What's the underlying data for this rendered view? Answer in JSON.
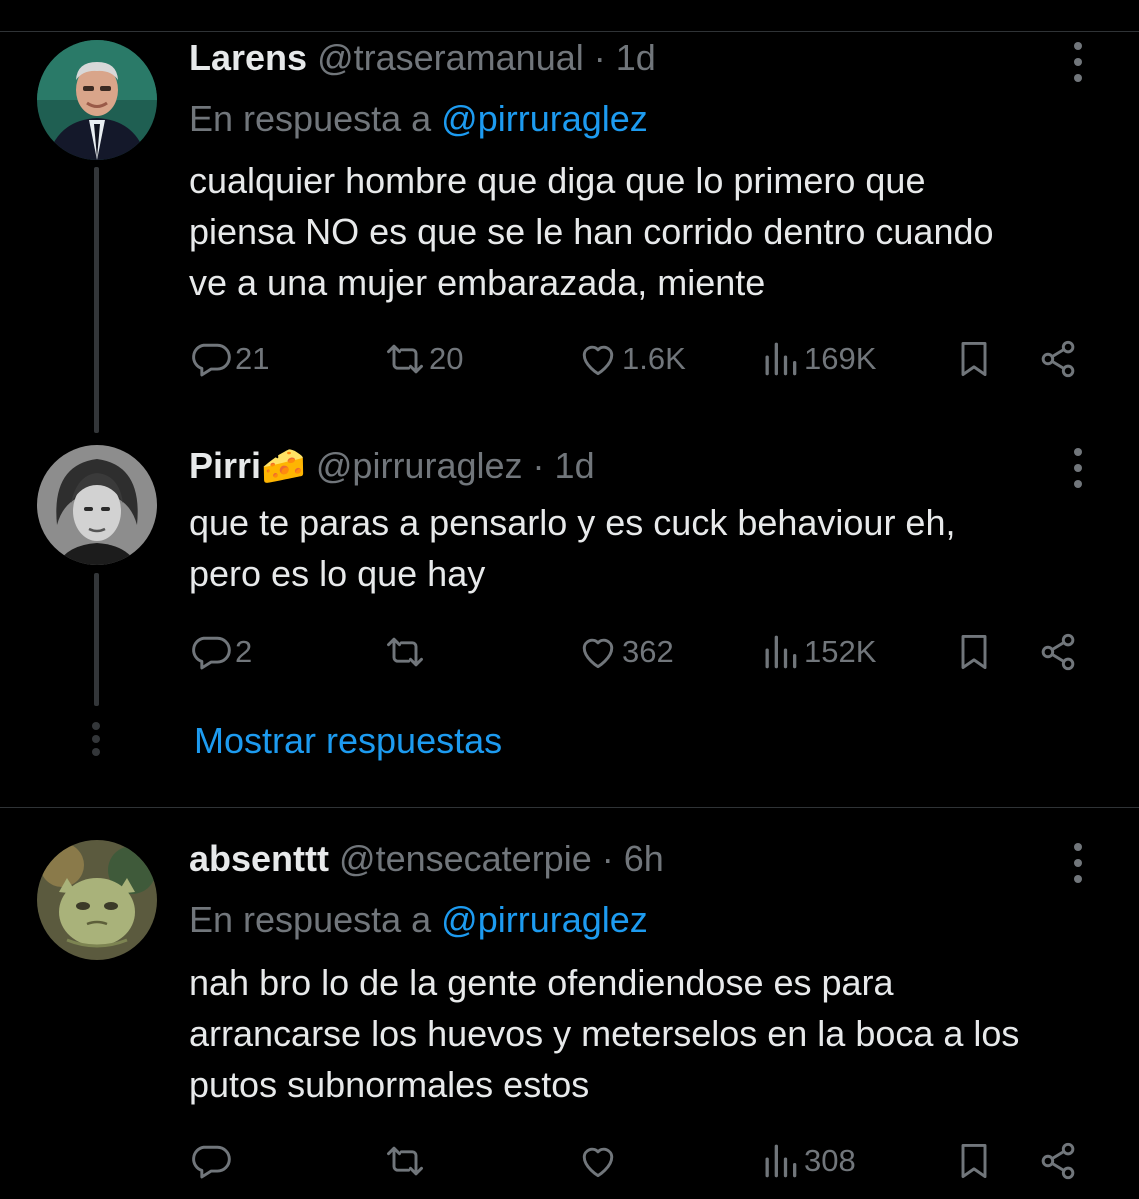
{
  "tweets": [
    {
      "name": "Larens",
      "handle": "@traseramanual",
      "separator": "·",
      "time": "1d",
      "reply_prefix": "En respuesta a",
      "reply_to": "@pirruraglez",
      "text_lines": [
        "cualquier hombre que diga que lo primero que",
        "piensa  NO es que se le han corrido dentro cuando",
        "ve a una mujer embarazada, miente"
      ],
      "replies": "21",
      "reposts": "20",
      "likes": "1.6K",
      "views": "169K"
    },
    {
      "name": "Pirri",
      "name_emoji": "🧀",
      "handle": "@pirruraglez",
      "separator": "·",
      "time": "1d",
      "text_lines": [
        "que te paras a pensarlo y es cuck behaviour eh,",
        "pero es lo que hay"
      ],
      "replies": "2",
      "reposts": "",
      "likes": "362",
      "views": "152K"
    },
    {
      "name": "absenttt",
      "handle": "@tensecaterpie",
      "separator": "·",
      "time": "6h",
      "reply_prefix": "En respuesta a",
      "reply_to": "@pirruraglez",
      "text_lines": [
        "nah bro lo de la gente ofendiendose es para",
        "arrancarse los huevos y meterselos en la boca a los",
        "putos subnormales estos"
      ],
      "replies": "",
      "reposts": "",
      "likes": "",
      "views": "308"
    }
  ],
  "show_replies_label": "Mostrar respuestas",
  "icons": {
    "reply": "speech-bubble-icon",
    "repost": "repost-arrows-icon",
    "like": "heart-icon",
    "views": "bar-chart-icon",
    "bookmark": "bookmark-icon",
    "share": "share-icon",
    "more": "more-vertical-icon"
  },
  "colors": {
    "background": "#000000",
    "text": "#e7e9ea",
    "secondary": "#71767b",
    "accent": "#1d9bf0",
    "line": "#333639"
  }
}
